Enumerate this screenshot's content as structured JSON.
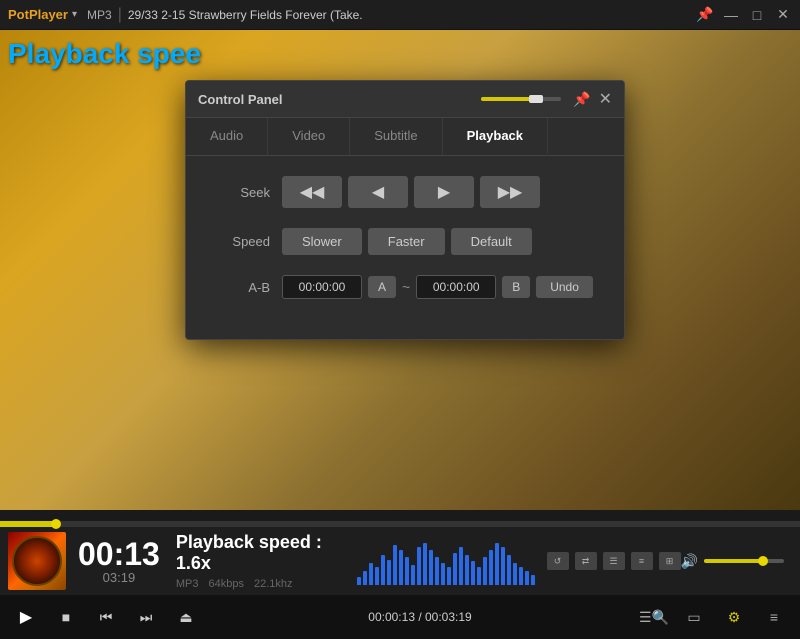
{
  "titleBar": {
    "appName": "PotPlayer",
    "format": "MP3",
    "trackNumber": "29/33",
    "trackTitle": "2-15 Strawberry Fields Forever (Take."
  },
  "overlay": {
    "playbackSpeedText": "Playback spee"
  },
  "controlPanel": {
    "title": "Control Panel",
    "tabs": [
      {
        "label": "Audio",
        "active": false
      },
      {
        "label": "Video",
        "active": false
      },
      {
        "label": "Subtitle",
        "active": false
      },
      {
        "label": "Playback",
        "active": true
      }
    ],
    "seekLabel": "Seek",
    "seekButtons": [
      {
        "symbol": "◀◀",
        "title": "seek-back-large"
      },
      {
        "symbol": "◀",
        "title": "seek-back-small"
      },
      {
        "symbol": "▶",
        "title": "seek-forward-small"
      },
      {
        "symbol": "▶▶",
        "title": "seek-forward-large"
      }
    ],
    "speedLabel": "Speed",
    "speedButtons": [
      {
        "label": "Slower"
      },
      {
        "label": "Faster"
      },
      {
        "label": "Default"
      }
    ],
    "abLabel": "A-B",
    "abTimeStart": "00:00:00",
    "abMarkerA": "A",
    "abTilde": "~",
    "abTimeEnd": "00:00:00",
    "abMarkerB": "B",
    "abUndo": "Undo"
  },
  "playerInfo": {
    "currentTime": "00:13",
    "totalTime": "03:19",
    "playbackSpeed": "Playback speed : 1.6x",
    "format": "MP3",
    "bitrate": "64kbps",
    "sampleRate": "22.1khz"
  },
  "progressBar": {
    "percent": 7
  },
  "visualizer": {
    "bars": [
      8,
      14,
      22,
      18,
      30,
      25,
      40,
      35,
      28,
      20,
      38,
      42,
      35,
      28,
      22,
      18,
      32,
      38,
      30,
      24,
      18,
      28,
      35,
      42,
      38,
      30,
      22,
      18,
      14,
      10
    ]
  },
  "transport": {
    "playSymbol": "▶",
    "stopSymbol": "■",
    "prevSymbol": "⏮",
    "nextSymbol": "⏭",
    "ejectSymbol": "⏏",
    "timeDisplay": "00:00:13 / 00:03:19"
  },
  "rightControls": {
    "playlistSymbol": "☰",
    "searchSymbol": "🔍",
    "subtitleSymbol": "▭",
    "gearSymbol": "⚙",
    "menuSymbol": "≡"
  }
}
